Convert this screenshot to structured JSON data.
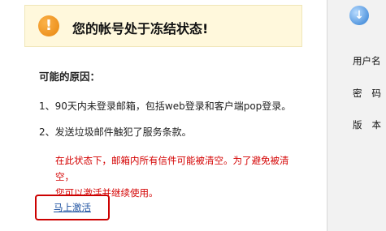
{
  "banner": {
    "title": "您的帐号处于冻结状态!"
  },
  "reasons": {
    "title": "可能的原因：",
    "items": [
      "1、90天内未登录邮箱，包括web登录和客户端pop登录。",
      "2、发送垃圾邮件触犯了服务条款。"
    ]
  },
  "notice": {
    "line1": "在此状态下，邮箱内所有信件可能被清空。为了避免被清空，",
    "line2": "您可以激活并继续使用。"
  },
  "action": {
    "activate_label": "马上激活"
  },
  "side": {
    "labels": [
      "用户名",
      "密码",
      "版本"
    ]
  },
  "colors": {
    "notice_red": "#d40000",
    "link_blue": "#1a4fa0",
    "banner_bg": "#fff8dc"
  },
  "icons": {
    "warning": "exclamation-icon",
    "download": "download-arrow-icon"
  }
}
